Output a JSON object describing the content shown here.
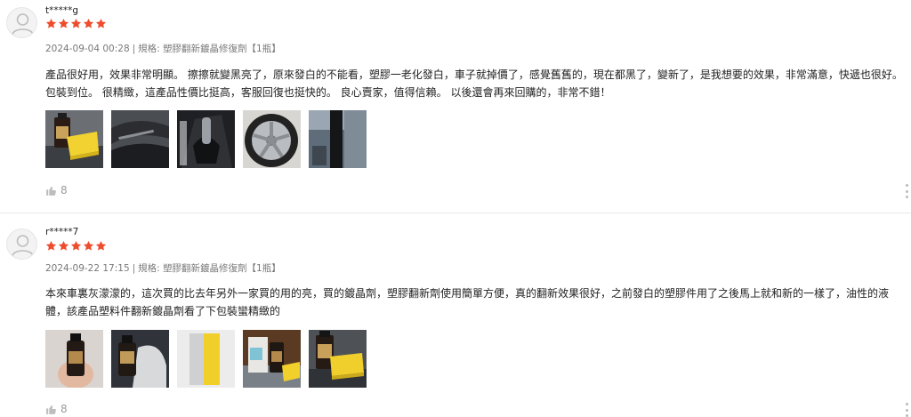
{
  "reviews": [
    {
      "username": "t*****g",
      "rating": 5,
      "date": "2024-09-04 00:28",
      "separator": "|",
      "spec": "規格: 塑膠翻新鍍晶修復劑【1瓶】",
      "content": "產品很好用，效果非常明顯。 擦擦就變黑亮了，原來發白的不能看，塑膠一老化發白，車子就掉價了，感覺舊舊的，現在都黑了，變新了，是我想要的效果，非常滿意，快遞也很好。 包裝到位。 很精緻，這產品性價比挺高，客服回復也挺快的。 良心賣家，值得信賴。 以後還會再來回購的，非常不錯！",
      "likes": "8",
      "images": [
        "product-with-sponge",
        "car-dashboard",
        "car-gear-shift",
        "car-wheel",
        "car-door-trim"
      ]
    },
    {
      "username": "r*****7",
      "rating": 5,
      "date": "2024-09-22 17:15",
      "separator": "|",
      "spec": "規格: 塑膠翻新鍍晶修復劑【1瓶】",
      "content": "本來車裏灰濛濛的，這次買的比去年另外一家買的用的亮，買的鍍晶劑，塑膠翻新劑使用簡單方便，真的翻新效果很好，之前發白的塑膠件用了之後馬上就和新的一樣了，油性的液體，該產品塑料件翻新鍍晶劑看了下包裝蠻精緻的",
      "likes": "8",
      "images": [
        "bottle-in-hand",
        "bottle-with-cloth",
        "sponge-block",
        "bottle-box-sponge",
        "product-with-sponge"
      ]
    }
  ],
  "colors": {
    "star": "#ee4d2d",
    "muted": "#9e9e9e"
  },
  "icons": {
    "avatar": "user-icon",
    "star": "star-icon",
    "like": "thumbs-up-icon",
    "more": "more-vertical-icon"
  }
}
